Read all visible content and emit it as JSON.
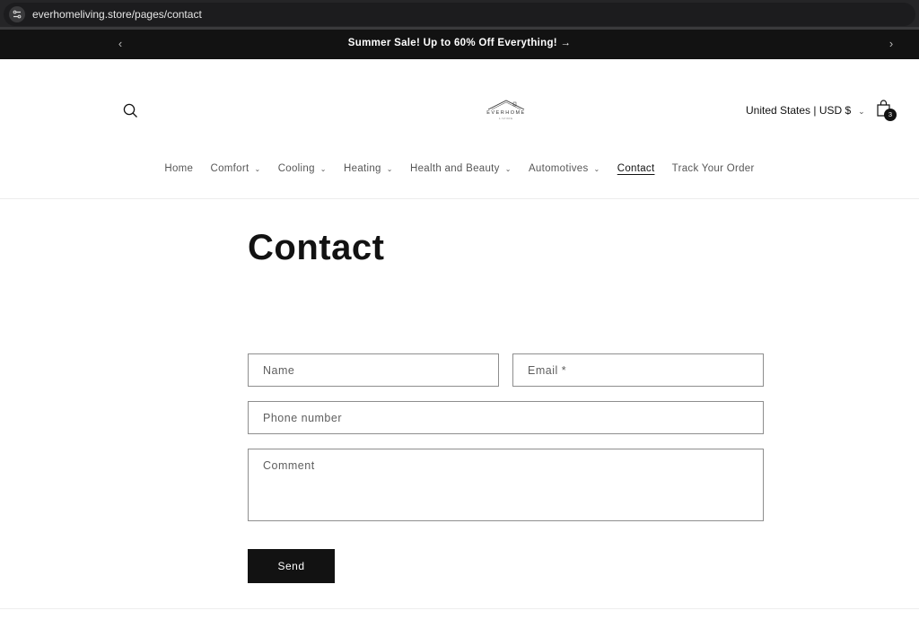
{
  "browser": {
    "url": "everhomeliving.store/pages/contact"
  },
  "announcement": {
    "text": "Summer Sale! Up to 60% Off Everything! →",
    "prev_icon": "‹",
    "next_icon": "›"
  },
  "header": {
    "logo_text": "EVERHOME",
    "logo_sub": "LIVING",
    "locale": "United States | USD $",
    "locale_chevron": "⌄",
    "cart_count": "3"
  },
  "nav": {
    "items": [
      {
        "label": "Home",
        "dropdown": false
      },
      {
        "label": "Comfort",
        "dropdown": true
      },
      {
        "label": "Cooling",
        "dropdown": true
      },
      {
        "label": "Heating",
        "dropdown": true
      },
      {
        "label": "Health and Beauty",
        "dropdown": true
      },
      {
        "label": "Automotives",
        "dropdown": true
      },
      {
        "label": "Contact",
        "dropdown": false,
        "active": true
      },
      {
        "label": "Track Your Order",
        "dropdown": false
      }
    ],
    "chevron": "⌄"
  },
  "page": {
    "title": "Contact"
  },
  "form": {
    "name_placeholder": "Name",
    "email_placeholder": "Email *",
    "phone_placeholder": "Phone number",
    "comment_placeholder": "Comment",
    "send_label": "Send"
  }
}
